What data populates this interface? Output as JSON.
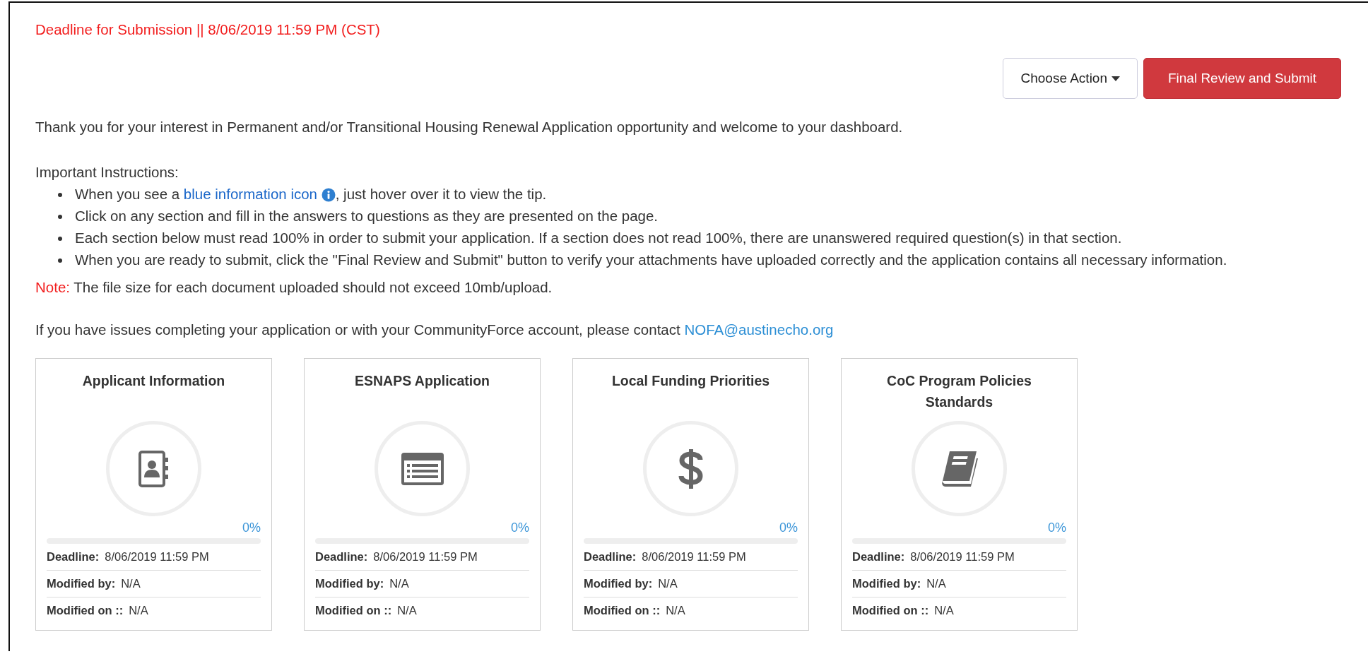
{
  "deadline_banner": "Deadline for Submission || 8/06/2019 11:59 PM (CST)",
  "actions": [
    {
      "kind": "dropdown",
      "label": "Choose Action"
    },
    {
      "kind": "primary",
      "label": "Final Review and Submit"
    }
  ],
  "intro": "Thank you for your interest in Permanent and/or Transitional Housing Renewal Application opportunity and welcome to your dashboard.",
  "instructions": {
    "heading": "Important Instructions:",
    "items": [
      {
        "kind": "tip",
        "text": "When you see a ",
        "link": "blue information icon",
        "after": ", just hover over it to view the tip."
      },
      {
        "kind": "text",
        "text": "Click on any section and fill in the answers to questions as they are presented on the page."
      },
      {
        "kind": "text",
        "text": "Each section below must read 100% in order to submit your application. If a section does not read 100%, there are unanswered required question(s) in that section."
      },
      {
        "kind": "text",
        "text": "When you are ready to submit, click the \"Final Review and Submit\" button to verify your attachments have uploaded correctly and the application contains all necessary information."
      }
    ]
  },
  "note": {
    "label": "Note:",
    "text": "The file size for each document uploaded should not exceed 10mb/upload."
  },
  "contact": {
    "text": "If you have issues completing your application or with your CommunityForce account, please contact ",
    "link": "NOFA@austinecho.org"
  },
  "sections": [
    {
      "title": "Applicant Information",
      "percent": "0%",
      "level": 0,
      "fields": [
        {
          "label": "Deadline:",
          "value": "8/06/2019 11:59 PM"
        },
        {
          "label": "Modified by:",
          "value": "N/A"
        },
        {
          "label": "Modified on ::",
          "value": "N/A"
        }
      ]
    },
    {
      "title": "ESNAPS Application",
      "percent": "0%",
      "level": 0,
      "fields": [
        {
          "label": "Deadline:",
          "value": "8/06/2019 11:59 PM"
        },
        {
          "label": "Modified by:",
          "value": "N/A"
        },
        {
          "label": "Modified on ::",
          "value": "N/A"
        }
      ]
    },
    {
      "title": "Local Funding Priorities",
      "percent": "0%",
      "level": 0,
      "fields": [
        {
          "label": "Deadline:",
          "value": "8/06/2019 11:59 PM"
        },
        {
          "label": "Modified by:",
          "value": "N/A"
        },
        {
          "label": "Modified on ::",
          "value": "N/A"
        }
      ]
    },
    {
      "title": "CoC Program Policies Standards",
      "percent": "0%",
      "level": 0,
      "fields": [
        {
          "label": "Deadline:",
          "value": "8/06/2019 11:59 PM"
        },
        {
          "label": "Modified by:",
          "value": "N/A"
        },
        {
          "label": "Modified on ::",
          "value": "N/A"
        }
      ]
    }
  ]
}
